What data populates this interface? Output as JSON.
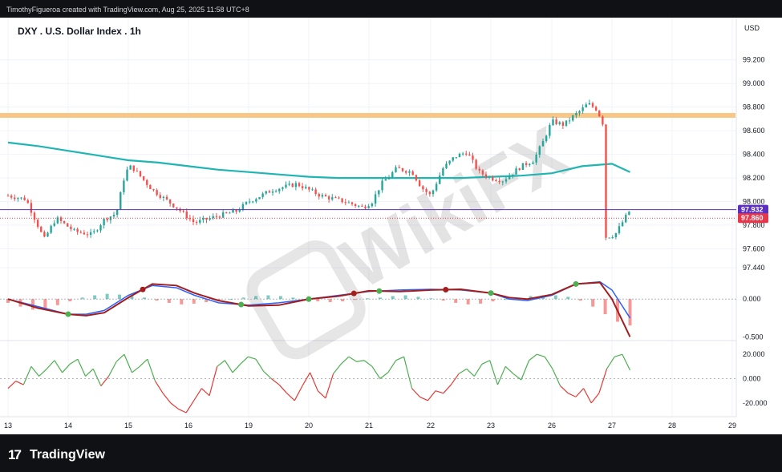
{
  "header": {
    "credit": "TimothyFigueroa created with TradingView.com, Aug 25, 2025 11:58 UTC+8"
  },
  "footer": {
    "brand": "TradingView",
    "logo_text": "17"
  },
  "watermark": {
    "text": "WikiFX"
  },
  "colors": {
    "background": "#ffffff",
    "frame": "#101114",
    "up": "#26a69a",
    "down": "#ef5350",
    "ma": "#1fb5b3",
    "resistance": "#f7c07a",
    "last_price": "#5a2fc2",
    "prev_close": "#e8374a",
    "macd": "#2962ff",
    "signal": "#a31d1d",
    "rsi_up": "#4caf50",
    "rsi_down": "#e53935"
  },
  "chart_data": {
    "type": "line",
    "title": "DXY . U.S. Dollar Index . 1h",
    "currency": "USD",
    "x_tick_labels": [
      "13",
      "14",
      "15",
      "16",
      "19",
      "20",
      "21",
      "22",
      "23",
      "26",
      "27",
      "28",
      "29"
    ],
    "main_panel": {
      "ylim": [
        97.4,
        99.3
      ],
      "y_ticks": [
        "99.200",
        "99.000",
        "98.800",
        "98.600",
        "98.400",
        "98.200",
        "98.000",
        "97.800",
        "97.600",
        "97.440"
      ],
      "price_path": {
        "x": [
          13.0,
          13.3,
          13.6,
          13.8,
          14.1,
          14.4,
          14.6,
          14.8,
          14.95,
          15.05,
          15.4,
          15.8,
          16.1,
          16.5,
          16.8,
          17.0,
          17.4,
          17.8,
          18.2,
          18.6,
          18.9,
          19.05,
          19.2,
          19.45,
          19.7,
          19.85,
          20.0,
          20.2,
          20.4,
          20.6,
          20.8,
          21.0,
          21.2,
          21.5,
          21.7,
          21.85,
          22.0,
          22.2,
          22.35,
          22.5,
          22.6,
          22.75,
          22.85,
          22.87,
          22.9,
          23.05,
          23.3
        ],
        "y": [
          98.05,
          98.02,
          97.68,
          97.86,
          97.75,
          97.72,
          97.85,
          97.9,
          98.25,
          98.3,
          98.1,
          97.95,
          97.82,
          97.88,
          97.92,
          98.0,
          98.1,
          98.15,
          98.05,
          98.0,
          97.95,
          98.0,
          98.15,
          98.28,
          98.25,
          98.12,
          98.05,
          98.28,
          98.38,
          98.42,
          98.25,
          98.2,
          98.18,
          98.3,
          98.35,
          98.5,
          98.68,
          98.65,
          98.72,
          98.78,
          98.83,
          98.78,
          98.66,
          97.88,
          97.7,
          97.72,
          97.93
        ]
      },
      "moving_average": {
        "x": [
          13.0,
          13.5,
          14.0,
          14.5,
          15.0,
          15.5,
          16.0,
          16.5,
          17.0,
          17.5,
          18.0,
          18.5,
          19.0,
          19.5,
          20.0,
          20.5,
          21.0,
          21.5,
          22.0,
          22.5,
          23.0,
          23.3
        ],
        "y": [
          98.5,
          98.47,
          98.43,
          98.39,
          98.35,
          98.33,
          98.3,
          98.27,
          98.25,
          98.23,
          98.21,
          98.2,
          98.2,
          98.2,
          98.2,
          98.2,
          98.21,
          98.22,
          98.24,
          98.3,
          98.32,
          98.25
        ]
      },
      "resistance_level": 98.73,
      "resistance_x_range": [
        13.0,
        25.0
      ],
      "last_price": "97.932",
      "prev_close": "97.860",
      "last_price_value": 97.932,
      "prev_close_value": 97.86
    },
    "macd_panel": {
      "ylim": [
        -0.55,
        0.3
      ],
      "y_ticks": [
        "0.000",
        "-0.500"
      ],
      "macd": {
        "x": [
          13.0,
          13.5,
          14.0,
          14.3,
          14.6,
          15.0,
          15.4,
          15.8,
          16.1,
          16.5,
          17.0,
          17.5,
          18.0,
          18.5,
          19.0,
          19.5,
          20.0,
          20.5,
          21.0,
          21.3,
          21.6,
          22.0,
          22.4,
          22.8,
          23.0,
          23.3
        ],
        "y": [
          0.0,
          -0.1,
          -0.2,
          -0.2,
          -0.15,
          0.05,
          0.18,
          0.15,
          0.05,
          -0.05,
          -0.08,
          -0.05,
          0.0,
          0.05,
          0.1,
          0.12,
          0.13,
          0.12,
          0.08,
          0.0,
          -0.02,
          0.05,
          0.2,
          0.23,
          0.12,
          -0.25
        ]
      },
      "signal": {
        "x": [
          13.0,
          13.5,
          14.0,
          14.3,
          14.6,
          15.0,
          15.4,
          15.8,
          16.1,
          16.5,
          17.0,
          17.5,
          18.0,
          18.5,
          19.0,
          19.5,
          20.0,
          20.5,
          21.0,
          21.3,
          21.6,
          22.0,
          22.4,
          22.8,
          23.0,
          23.3
        ],
        "y": [
          0.0,
          -0.12,
          -0.2,
          -0.22,
          -0.18,
          0.02,
          0.2,
          0.18,
          0.08,
          -0.02,
          -0.09,
          -0.08,
          0.0,
          0.04,
          0.11,
          0.1,
          0.12,
          0.13,
          0.08,
          0.02,
          0.0,
          0.06,
          0.2,
          0.22,
          0.0,
          -0.5
        ]
      },
      "histogram": [
        -0.05,
        -0.1,
        -0.14,
        -0.12,
        -0.08,
        -0.03,
        0.02,
        0.05,
        0.07,
        0.06,
        0.04,
        0.02,
        -0.02,
        -0.05,
        -0.07,
        -0.06,
        -0.04,
        -0.02,
        0.0,
        0.02,
        0.04,
        0.05,
        0.04,
        0.02,
        -0.01,
        -0.03,
        -0.04,
        -0.03,
        -0.01,
        0.01,
        0.02,
        0.04,
        0.05,
        0.03,
        0.01,
        -0.02,
        -0.05,
        -0.07,
        -0.06,
        -0.03,
        0.0,
        0.02,
        0.04,
        0.05,
        0.05,
        0.03,
        -0.02,
        -0.1,
        -0.2,
        -0.3,
        -0.35
      ]
    },
    "rsi_panel": {
      "ylim": [
        -28,
        28
      ],
      "y_ticks": [
        "20.000",
        "0.000",
        "-20.000"
      ],
      "values": [
        -8,
        -2,
        -5,
        10,
        2,
        8,
        15,
        5,
        12,
        16,
        2,
        8,
        -6,
        2,
        14,
        20,
        5,
        10,
        16,
        -2,
        -12,
        -20,
        -25,
        -28,
        -18,
        -8,
        -14,
        10,
        15,
        5,
        12,
        18,
        16,
        6,
        0,
        -5,
        -12,
        -18,
        -6,
        5,
        -10,
        -16,
        4,
        12,
        18,
        14,
        15,
        10,
        0,
        5,
        15,
        18,
        -8,
        -15,
        -18,
        -10,
        -12,
        -5,
        4,
        8,
        2,
        12,
        15,
        -5,
        10,
        4,
        -1,
        15,
        20,
        18,
        8,
        -6,
        -12,
        -15,
        -8,
        -20,
        -12,
        8,
        18,
        20,
        7
      ]
    }
  }
}
